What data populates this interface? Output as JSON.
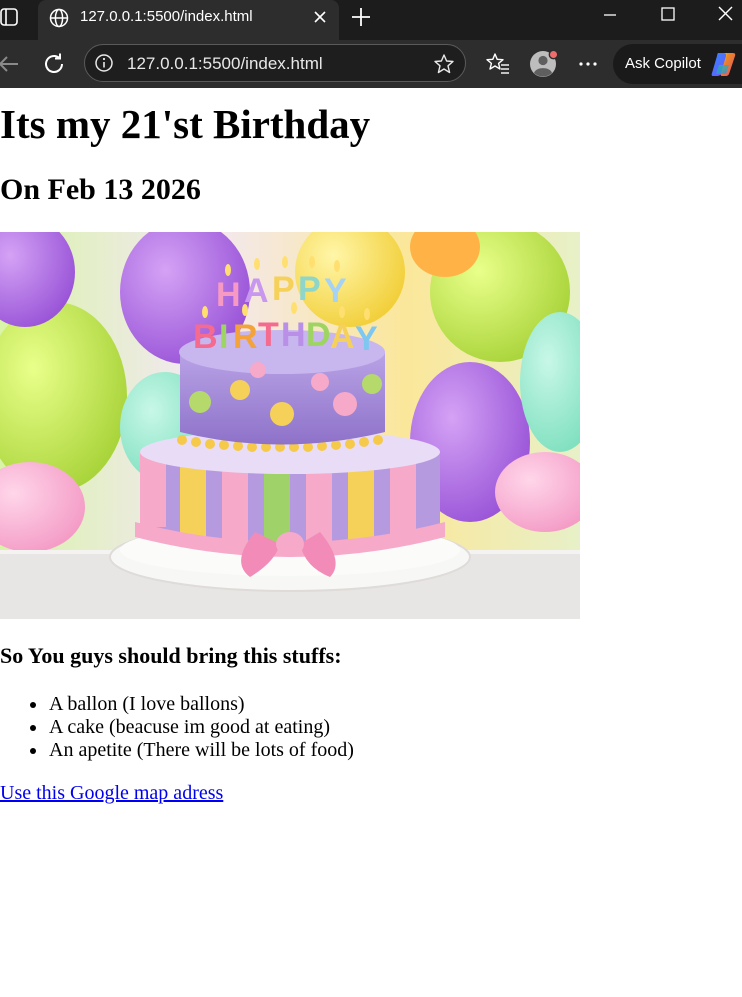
{
  "browser": {
    "tab_title": "127.0.0.1:5500/index.html",
    "url": "127.0.0.1:5500/index.html",
    "copilot_label": "Ask Copilot"
  },
  "page": {
    "heading": "Its my 21'st Birthday",
    "date": "On Feb 13 2026",
    "image_caption_text": "HAPPY BIRTHDAY",
    "list_intro": "So You guys should bring this stuffs:",
    "items": [
      "A ballon (I love ballons)",
      "A cake (beacuse im good at eating)",
      "An apetite (There will be lots of food)"
    ],
    "link_text": "Use this Google map adress"
  },
  "colors": {
    "link": "#0000ee",
    "chrome_bg": "#1c1c1c",
    "toolbar_bg": "#2d2d2d"
  }
}
